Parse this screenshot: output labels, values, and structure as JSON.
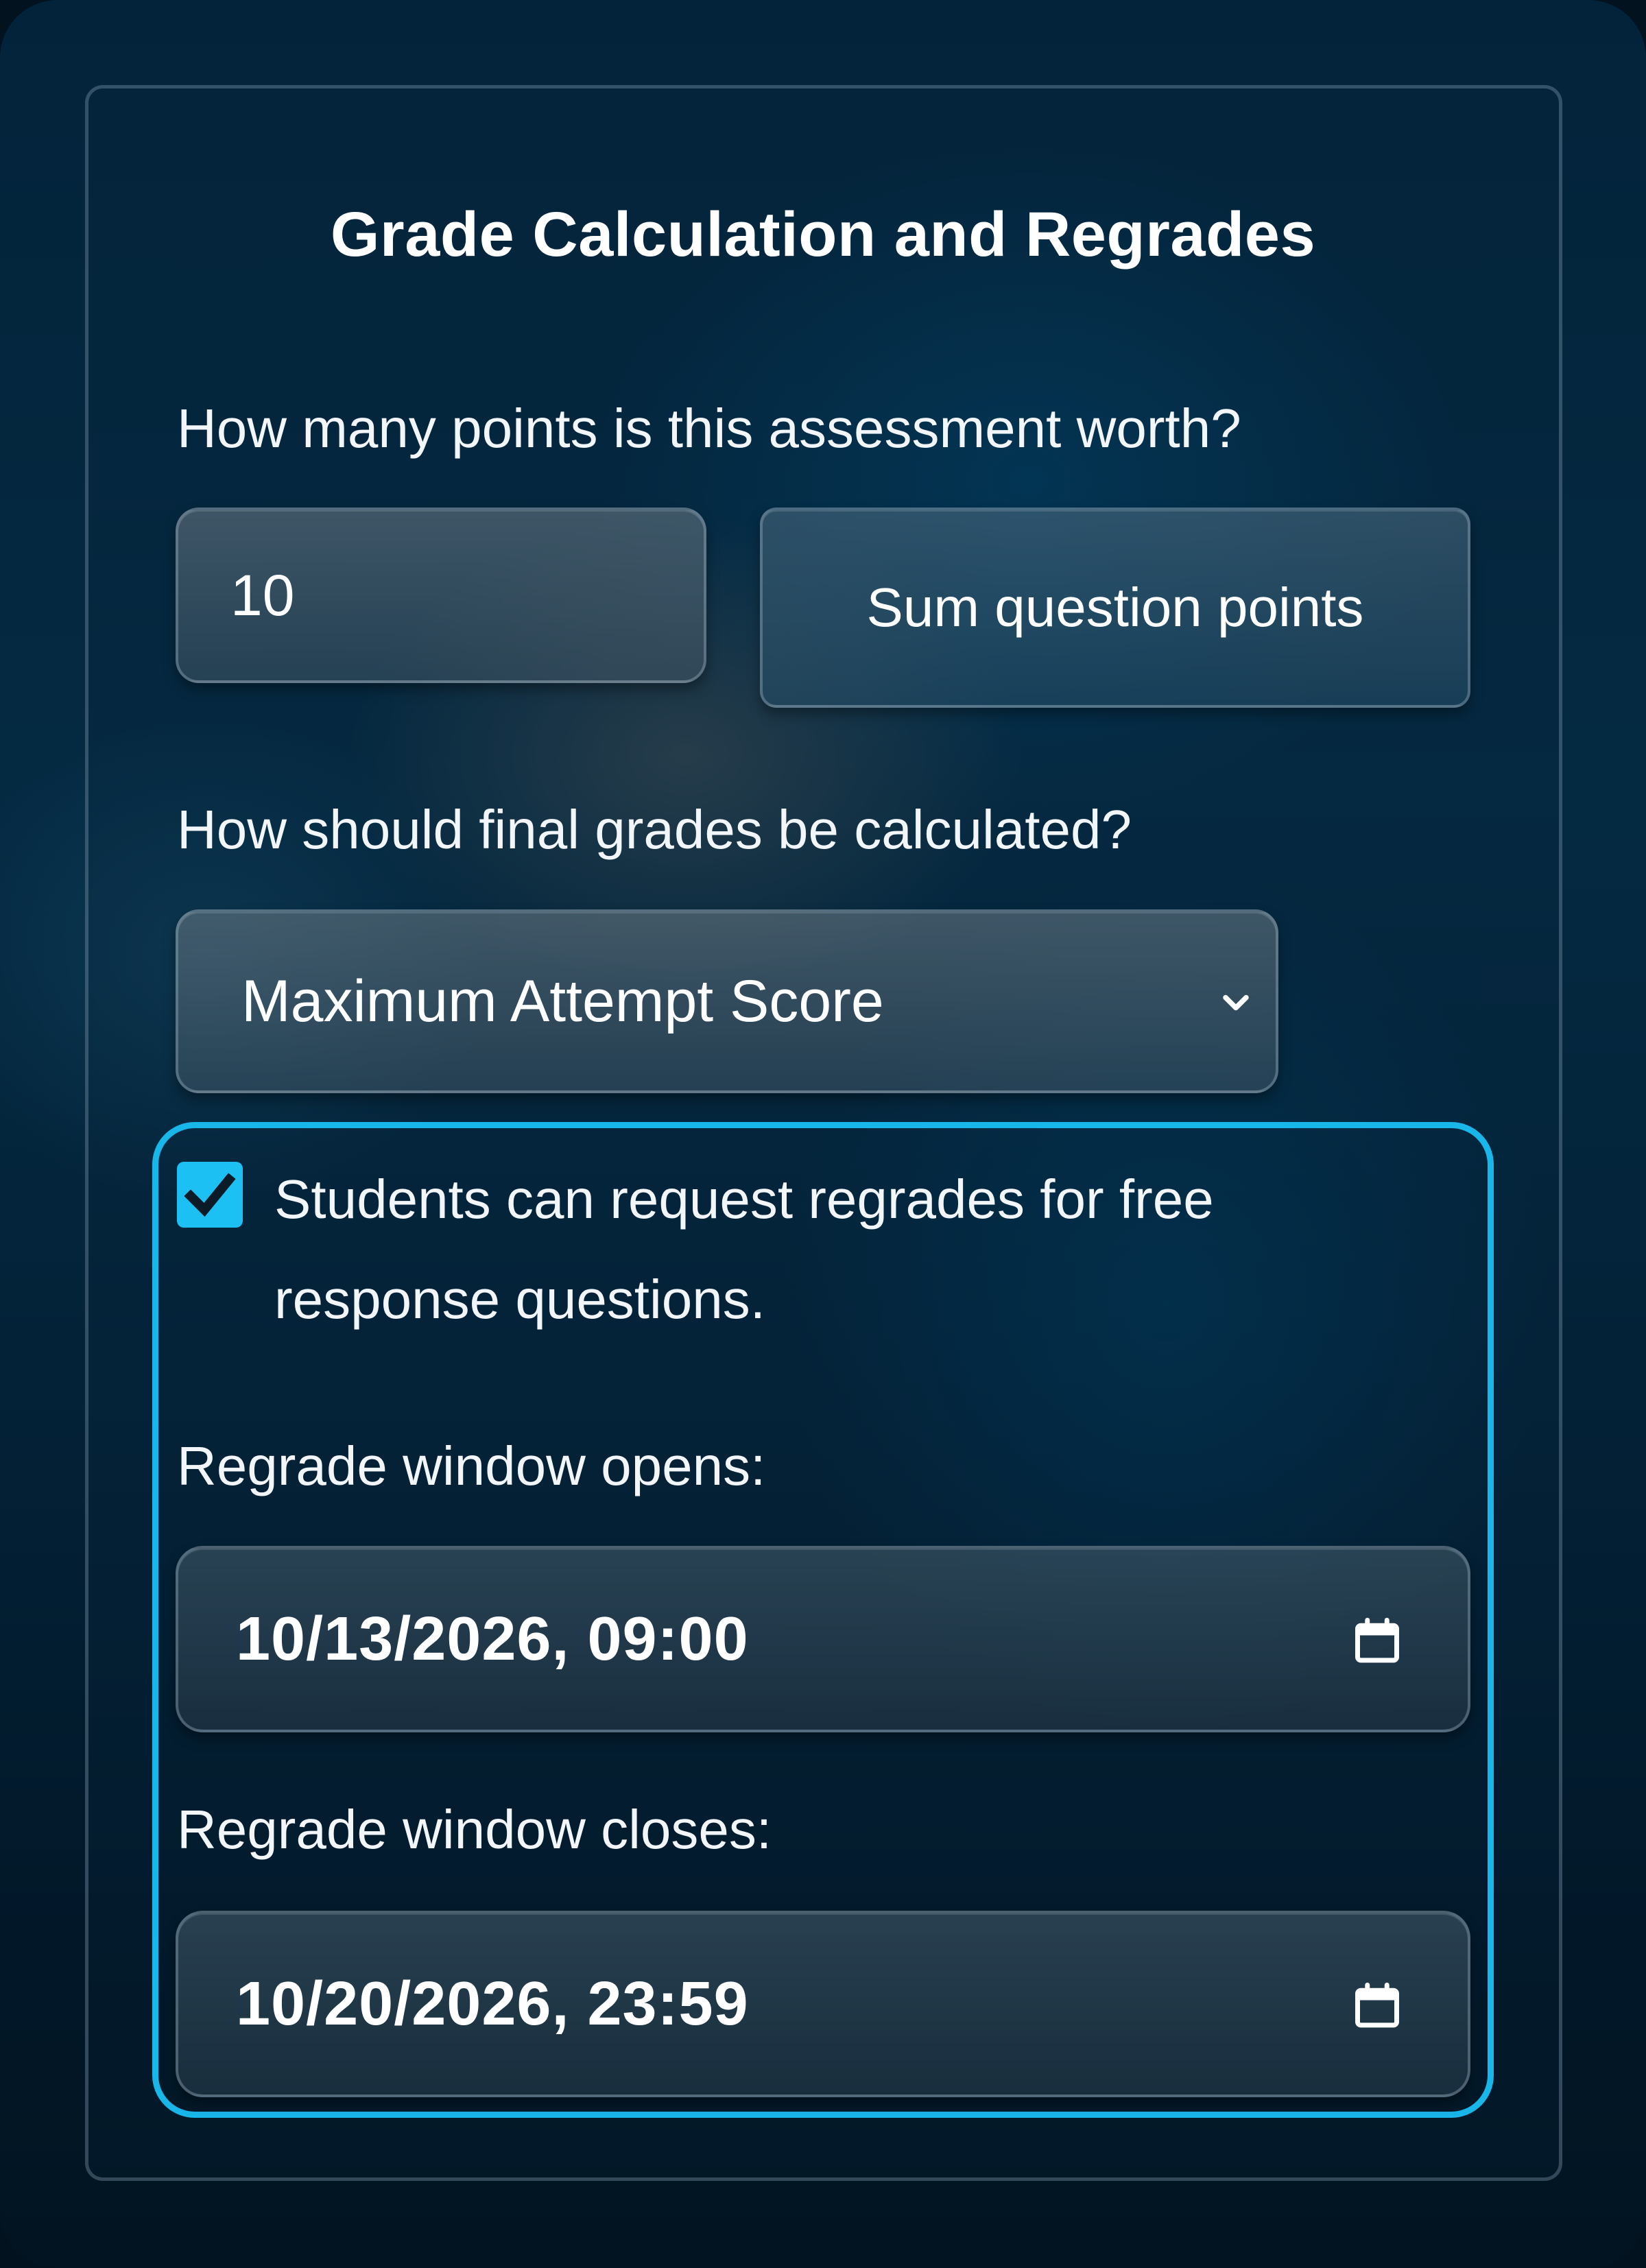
{
  "form": {
    "title": "Grade Calculation and Regrades",
    "points_label": "How many points is this assessment worth?",
    "points_value": "10",
    "sum_button_label": "Sum question points",
    "grade_label": "How should final grades be calculated?",
    "grade_selected": "Maximum Attempt Score",
    "regrade_checked": true,
    "regrade_checkbox_label": "Students can request regrades for free response questions.",
    "opens_label": "Regrade window opens:",
    "opens_value": "10/13/2026, 09:00",
    "closes_label": "Regrade window closes:",
    "closes_value": "10/20/2026, 23:59"
  },
  "icons": {
    "select_arrow": "chevron-down-icon",
    "checkbox_mark": "checkmark-icon",
    "date_picker": "calendar-icon"
  },
  "colors": {
    "accent": "#19b6ea",
    "checkbox": "#1cc0f2",
    "text": "#ffffff"
  }
}
